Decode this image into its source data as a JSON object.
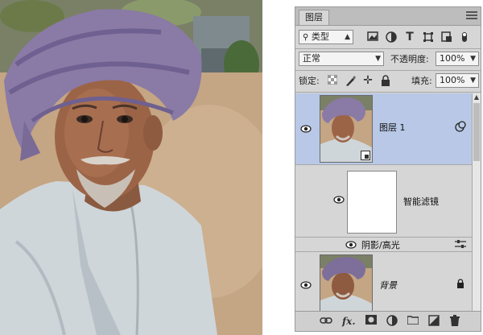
{
  "panel": {
    "title": "图层",
    "filter_type": "类型",
    "blend_mode": "正常",
    "opacity_label": "不透明度:",
    "opacity_value": "100%",
    "lock_label": "锁定:",
    "fill_label": "填充:",
    "fill_value": "100%"
  },
  "filter_icons": [
    "image-filter-icon",
    "adjustment-filter-icon",
    "type-filter-icon",
    "shape-filter-icon",
    "smart-object-filter-icon"
  ],
  "lock_icons": [
    "lock-transparent-icon",
    "lock-image-icon",
    "lock-position-icon",
    "lock-all-icon"
  ],
  "layers": [
    {
      "name": "图层 1",
      "type": "smart-object",
      "selected": true
    },
    {
      "name": "智能滤镜",
      "type": "smart-filter-mask"
    },
    {
      "name": "阴影/高光",
      "type": "filter-effect"
    },
    {
      "name": "背景",
      "type": "background",
      "locked": true
    }
  ],
  "footer_icons": [
    "link-icon",
    "fx-icon",
    "mask-icon",
    "adjustment-icon",
    "group-folder-icon",
    "new-layer-icon",
    "trash-icon"
  ],
  "colors": {
    "panel_bg": "#d6d6d6",
    "selected_row": "#b8c8e6"
  }
}
